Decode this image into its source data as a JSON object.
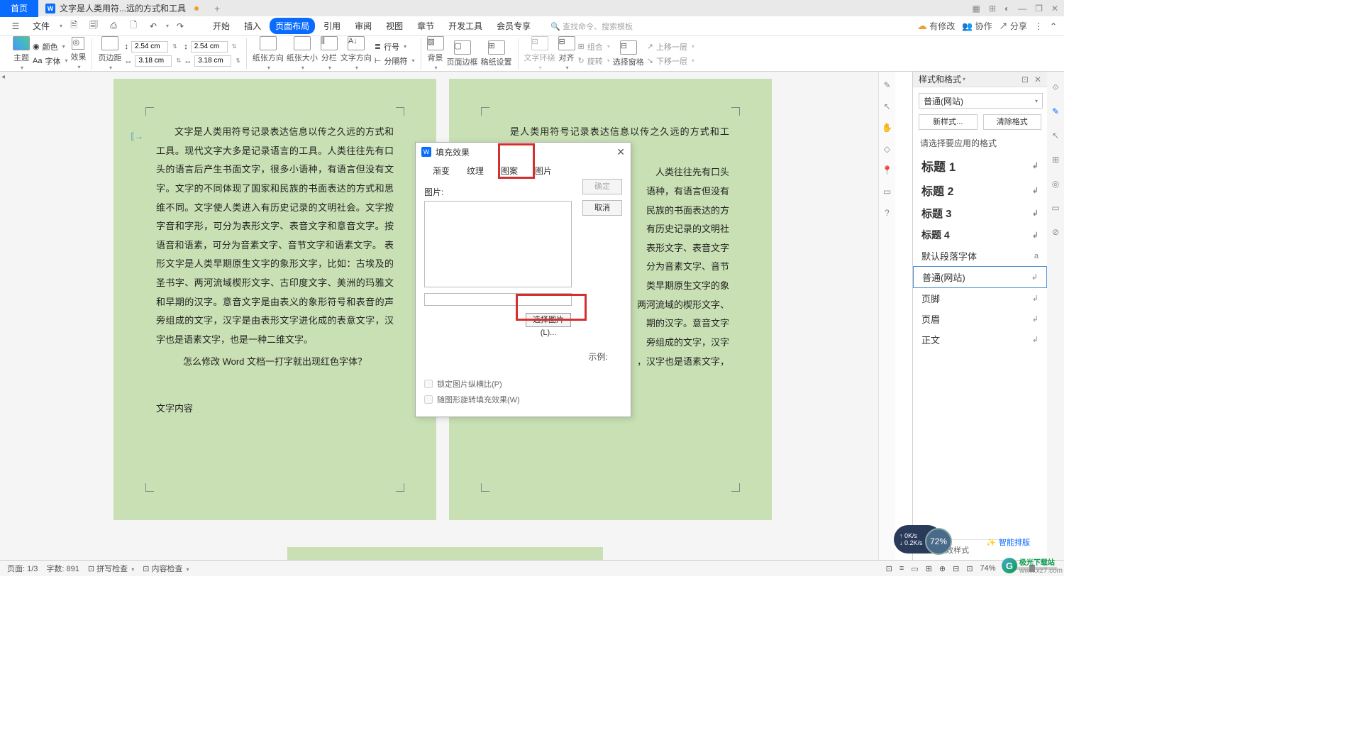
{
  "titlebar": {
    "home_tab": "首页",
    "doc_tab": "文字是人类用符...远的方式和工具",
    "add": "+"
  },
  "menubar": {
    "file": "文件",
    "items": [
      "开始",
      "插入",
      "页面布局",
      "引用",
      "审阅",
      "视图",
      "章节",
      "开发工具",
      "会员专享"
    ],
    "active_index": 2,
    "search_placeholder": "查找命令、搜索模板",
    "right": {
      "modify": "有修改",
      "collab": "协作",
      "share": "分享"
    }
  },
  "ribbon": {
    "theme": "主题",
    "color": "颜色",
    "font": "字体",
    "effect": "效果",
    "margin": "页边距",
    "top": "2.54 cm",
    "bottom": "2.54 cm",
    "left": "3.18 cm",
    "right": "3.18 cm",
    "orientation": "纸张方向",
    "size": "纸张大小",
    "column": "分栏",
    "txtdir": "文字方向",
    "lineno": "行号",
    "sep": "分隔符",
    "bg": "背景",
    "border": "页面边框",
    "paper": "稿纸设置",
    "wrap": "文字环绕",
    "align": "对齐",
    "rotate": "旋转",
    "pane": "选择窗格",
    "group": "组合",
    "upone": "上移一层",
    "downone": "下移一层"
  },
  "page1": {
    "p1": "文字是人类用符号记录表达信息以传之久远的方式和工具。现代文字大多是记录语言的工具。人类往往先有口头的语言后产生书面文字，很多小语种，有语言但没有文字。文字的不同体现了国家和民族的书面表达的方式和思维不同。文字使人类进入有历史记录的文明社会。文字按字音和字形，可分为表形文字、表音文字和意音文字。按语音和语素，可分为音素文字、音节文字和语素文字。 表形文字是人类早期原生文字的象形文字，比如：古埃及的圣书字、两河流域楔形文字、古印度文字、美洲的玛雅文和早期的汉字。意音文字是由表义的象形符号和表音的声旁组成的文字，汉字是由表形文字进化成的表意文字，汉字也是语素文字，也是一种二维文字。",
    "p2": "怎么修改 Word 文档一打字就出现红色字体？",
    "p3": "文字内容"
  },
  "page2": {
    "p1": "是人类用符号记录表达信息以传之久远的方式和工具。",
    "p2": "人类往往先有口头",
    "p3": "语种，有语言但没有",
    "p4": "民族的书面表达的方",
    "p5": "有历史记录的文明社",
    "p6": "表形文字、表音文字",
    "p7": "分为音素文字、音节",
    "p8": "类早期原生文字的象",
    "p9": "两河流域的楔形文字、",
    "p10": "期的汉字。意音文字",
    "p11": "旁组成的文字，汉字",
    "p12": "，汉字也是语素文字，"
  },
  "dialog": {
    "title": "填充效果",
    "tabs": [
      "渐变",
      "纹理",
      "图案",
      "图片"
    ],
    "active_tab": 3,
    "pic_label": "图片:",
    "pick_btn": "选择图片(L)...",
    "example": "示例:",
    "lock_ratio": "锁定图片纵横比(P)",
    "rotate_fill": "随图形旋转填充效果(W)",
    "ok": "确定",
    "cancel": "取消"
  },
  "right_panel": {
    "title": "样式和格式",
    "current": "普通(网站)",
    "new_style": "新样式...",
    "clear": "清除格式",
    "subtitle": "请选择要应用的格式",
    "items": [
      {
        "label": "标题 1",
        "cls": "h1"
      },
      {
        "label": "标题 2",
        "cls": "h2"
      },
      {
        "label": "标题 3",
        "cls": "h3"
      },
      {
        "label": "标题 4",
        "cls": "h4"
      },
      {
        "label": "默认段落字体",
        "cls": ""
      },
      {
        "label": "普通(网站)",
        "cls": "selected"
      },
      {
        "label": "页脚",
        "cls": ""
      },
      {
        "label": "页眉",
        "cls": ""
      },
      {
        "label": "正文",
        "cls": ""
      }
    ],
    "footer": "显示  有效样式"
  },
  "statusbar": {
    "page": "页面: 1/3",
    "words": "字数: 891",
    "spell": "拼写检查",
    "content": "内容检查",
    "zoom": "74%"
  },
  "badges": {
    "up": "0K/s",
    "down": "0.2K/s",
    "percent": "72%",
    "smart": "智能排版",
    "dl1": "极光下载站",
    "dl2": "www.xz7.com"
  }
}
